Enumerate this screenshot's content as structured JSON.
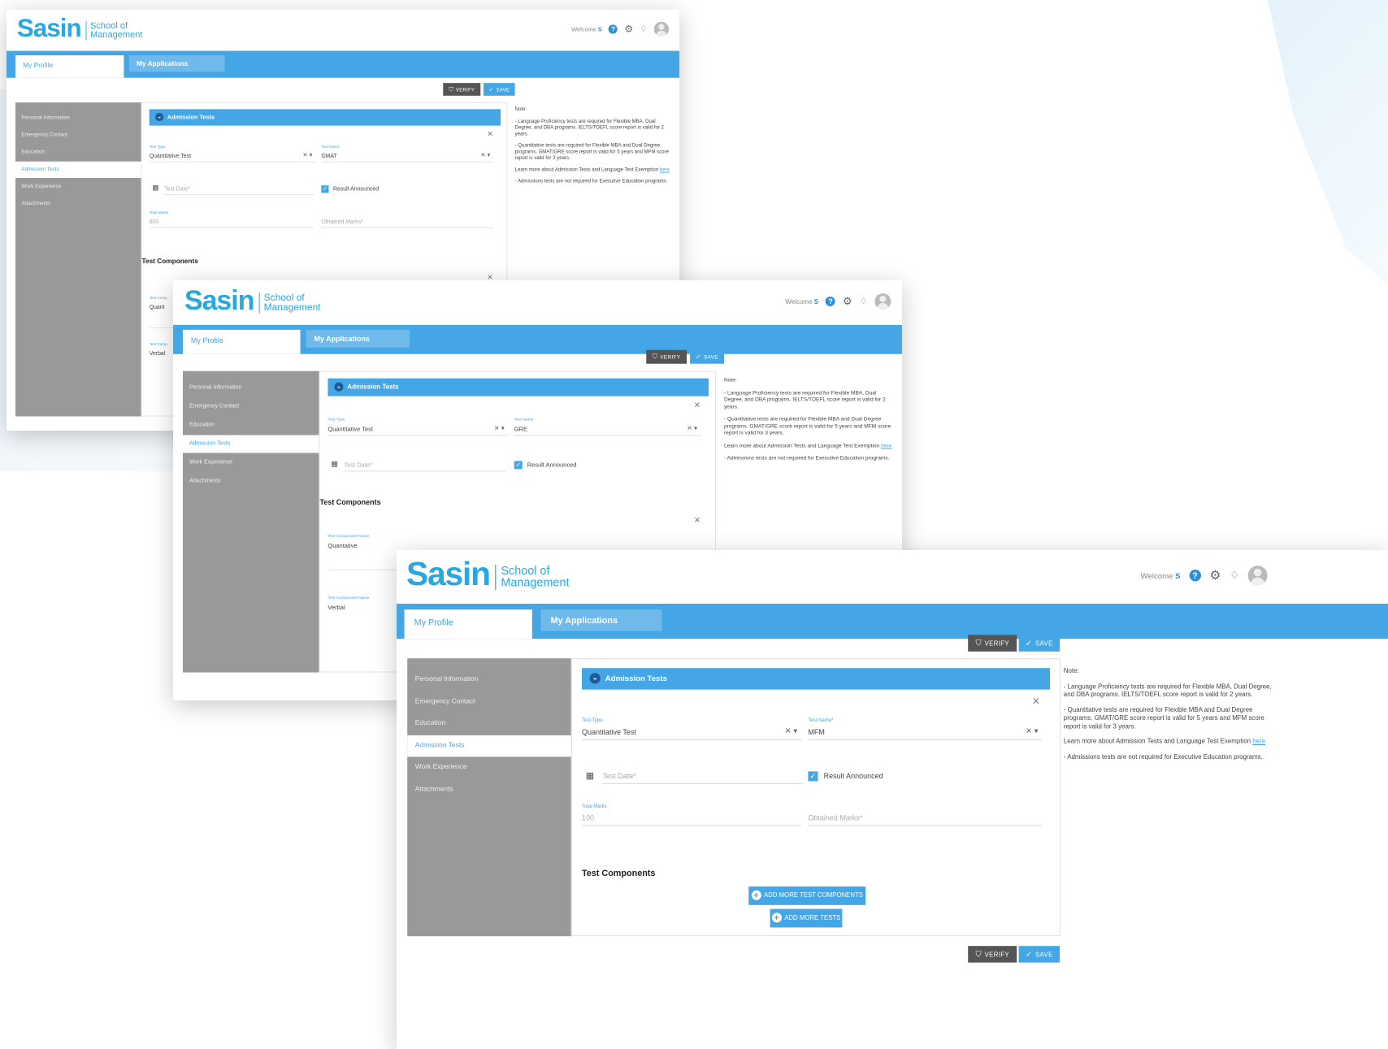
{
  "brand": {
    "name": "Sasin",
    "school_line1": "School of",
    "school_line2": "Management"
  },
  "header": {
    "welcome": "Welcome",
    "user_initial": "S",
    "help_glyph": "?"
  },
  "tabs": {
    "profile": "My Profile",
    "applications": "My Applications"
  },
  "buttons": {
    "verify": "VERIFY",
    "save": "SAVE"
  },
  "sidebar": {
    "items": [
      "Personal Information",
      "Emergency Contact",
      "Education",
      "Admission Tests",
      "Work Experience",
      "Attachments"
    ],
    "active_index": 3
  },
  "section": {
    "title": "Admission Tests"
  },
  "fields": {
    "test_type_label": "Test Type",
    "test_name_label": "Test Name",
    "test_name_label_required": "Test Name*",
    "test_date_placeholder": "Test Date*",
    "result_announced": "Result Announced",
    "total_marks_label": "Total Marks",
    "obtained_marks_placeholder": "Obtained Marks*"
  },
  "screens": [
    {
      "test_type": "Quantitative Test",
      "test_name": "GMAT",
      "total_marks": "800"
    },
    {
      "test_type": "Quantitative Test",
      "test_name": "GRE"
    },
    {
      "test_type": "Quantitative Test",
      "test_name": "MFM",
      "total_marks": "100"
    }
  ],
  "components": {
    "title": "Test Components",
    "name_label": "Test Component Name",
    "items": [
      "Quantative",
      "Verbal"
    ],
    "items_back_cropped": [
      "Quant",
      "Verbal"
    ],
    "label_cropped": "Test Comp"
  },
  "actions": {
    "add_components": "ADD MORE TEST COMPONENTS",
    "add_tests": "ADD MORE TESTS"
  },
  "note": {
    "heading": "Note:",
    "p1": "- Language Proficiency tests are required for Flexible MBA, Dual Degree, and DBA programs. IELTS/TOEFL score report is valid for 2 years.",
    "p2": "- Quantitative tests are required for Flexible MBA and Dual Degree programs. GMAT/GRE score report is valid for 5 years and MFM score report is valid for 3 years.",
    "p3": "Learn more about Admission Tests and Language Test Exemption",
    "p3_link": "here",
    "p4": "- Admissions tests are not required for Executive Education programs."
  },
  "icons": {
    "help": "help-icon",
    "settings": "gear-icon",
    "notifications": "bell-icon",
    "avatar": "user-avatar-icon"
  },
  "colors": {
    "accent": "#44a6e4",
    "brand": "#29a8e0",
    "sidebar": "#999999",
    "verify": "#555555"
  }
}
